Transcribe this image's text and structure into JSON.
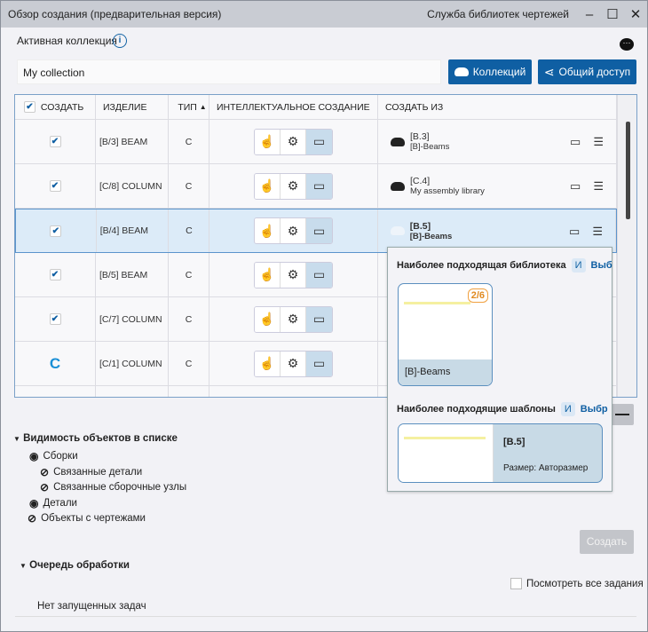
{
  "window": {
    "title": "Обзор создания (предварительная версия)",
    "app": "Служба библиотек чертежей"
  },
  "collection": {
    "label": "Активная коллекция",
    "value": "My collection",
    "collections_button": "Коллекций",
    "share_button": "Общий доступ"
  },
  "table": {
    "headers": [
      "СОЗДАТЬ",
      "ИЗДЕЛИЕ",
      "ТИП",
      "ИНТЕЛЛЕКТУАЛЬНОЕ СОЗДАНИЕ",
      "СОЗДАТЬ ИЗ"
    ],
    "rows": [
      {
        "state": "checked",
        "item": "[B/3] BEAM",
        "type": "C",
        "from_title": "[B.3]",
        "from_lib": "[B]-Beams"
      },
      {
        "state": "checked",
        "item": "[C/8] COLUMN",
        "type": "C",
        "from_title": "[C.4]",
        "from_lib": "My assembly library"
      },
      {
        "state": "checked",
        "item": "[B/4] BEAM",
        "type": "C",
        "from_title": "[B.5]",
        "from_lib": "[B]-Beams",
        "selected": true
      },
      {
        "state": "checked",
        "item": "[B/5] BEAM",
        "type": "C"
      },
      {
        "state": "checked",
        "item": "[C/7] COLUMN",
        "type": "C"
      },
      {
        "state": "loading",
        "item": "[C/1] COLUMN",
        "type": "C"
      }
    ]
  },
  "popup": {
    "library_heading": "Наиболее подходящая библиотека",
    "and": "И",
    "select": "Выб",
    "library_card": {
      "name": "[B]-Beams",
      "badge": "2/6"
    },
    "templates_heading": "Наиболее подходящие шаблоны",
    "select2": "Выбр",
    "template_card": {
      "name": "[B.5]",
      "size": "Размер: Авторазмер"
    }
  },
  "visibility": {
    "heading": "Видимость объектов в списке",
    "items": [
      {
        "label": "Сборки",
        "visible": true
      },
      {
        "label": "Связанные детали",
        "visible": false
      },
      {
        "label": "Связанные сборочные узлы",
        "visible": false
      },
      {
        "label": "Детали",
        "visible": true
      },
      {
        "label": "Объекты с чертежами",
        "visible": false
      }
    ]
  },
  "create_button": "Создать",
  "queue": {
    "heading": "Очередь обработки",
    "view_all": "Посмотреть все задания",
    "empty": "Нет запущенных задач"
  },
  "colors": {
    "accent": "#0f5fa3",
    "selected_row": "#dcebf8",
    "badge": "#e08a20"
  }
}
